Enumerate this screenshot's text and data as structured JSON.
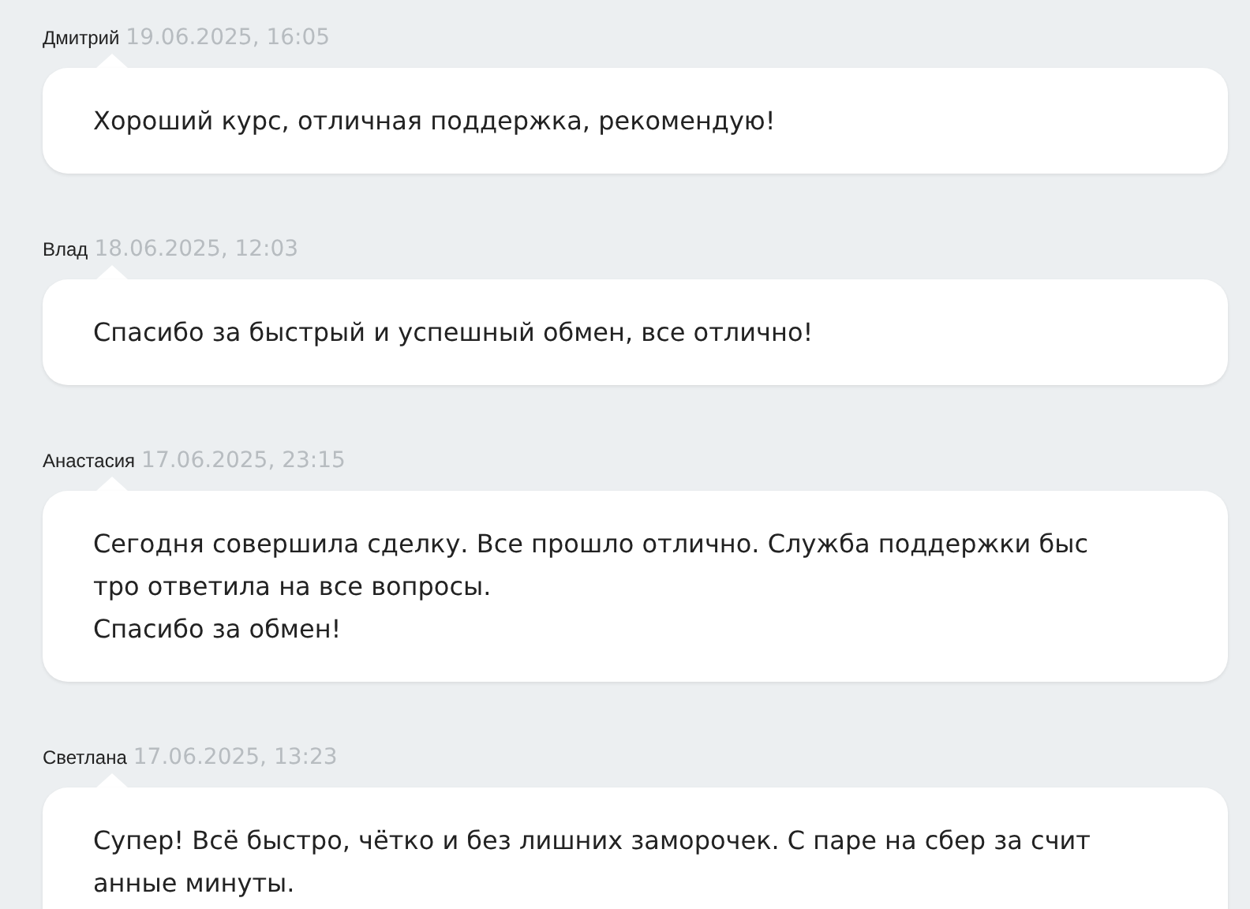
{
  "reviews": [
    {
      "author": "Дмитрий",
      "date": "19.06.2025, 16:05",
      "lines": [
        "Хороший курс, отличная поддержка, рекомендую!"
      ]
    },
    {
      "author": "Влад",
      "date": "18.06.2025, 12:03",
      "lines": [
        "Спасибо за быстрый и успешный обмен, все отлично!"
      ]
    },
    {
      "author": "Анастасия",
      "date": "17.06.2025, 23:15",
      "lines": [
        "Сегодня совершила сделку. Все прошло отлично. Служба поддержки быс",
        "тро ответила на все вопросы.",
        "Спасибо за обмен!"
      ]
    },
    {
      "author": "Светлана",
      "date": "17.06.2025, 13:23",
      "lines": [
        "Супер! Всё быстро, чётко и без лишних заморочек. С паре на сбер за счит",
        "анные минуты."
      ]
    }
  ]
}
